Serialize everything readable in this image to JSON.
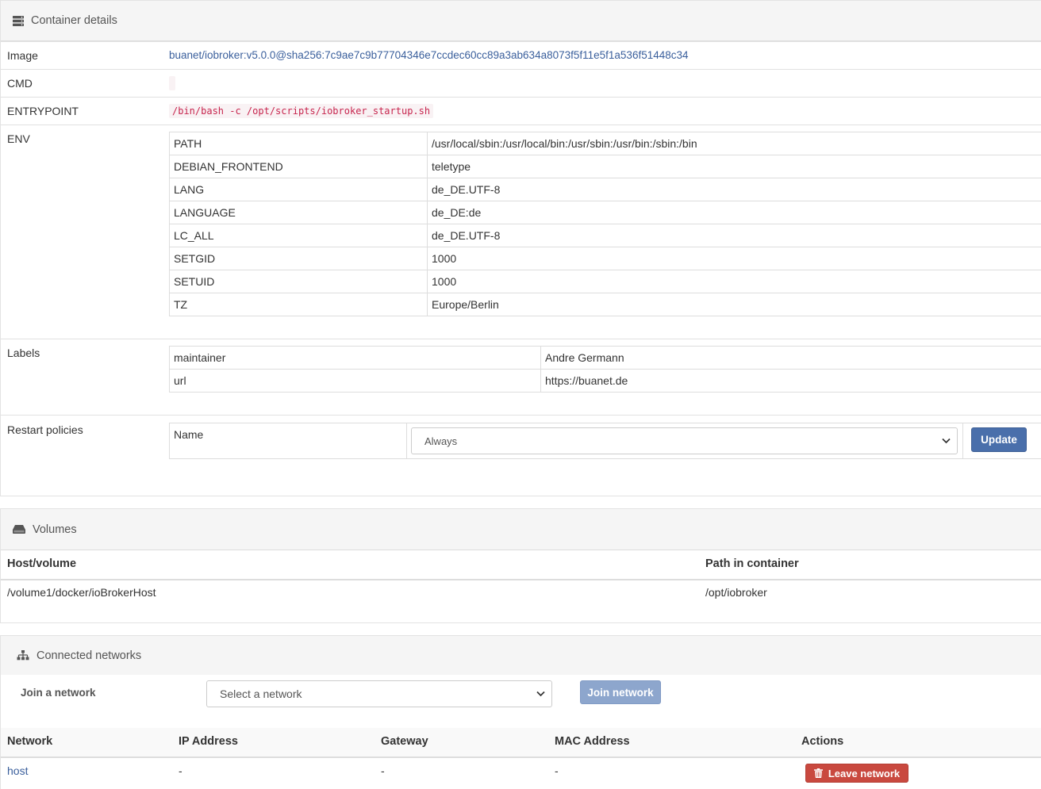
{
  "details": {
    "title": "Container details",
    "image": {
      "label": "Image",
      "value": "buanet/iobroker:v5.0.0@sha256:7c9ae7c9b77704346e7ccdec60cc89a3ab634a8073f5f11e5f1a536f51448c34"
    },
    "cmd": {
      "label": "CMD"
    },
    "entrypoint": {
      "label": "ENTRYPOINT",
      "value": "/bin/bash -c /opt/scripts/iobroker_startup.sh"
    },
    "env": {
      "label": "ENV",
      "rows": [
        {
          "key": "PATH",
          "value": "/usr/local/sbin:/usr/local/bin:/usr/sbin:/usr/bin:/sbin:/bin"
        },
        {
          "key": "DEBIAN_FRONTEND",
          "value": "teletype"
        },
        {
          "key": "LANG",
          "value": "de_DE.UTF-8"
        },
        {
          "key": "LANGUAGE",
          "value": "de_DE:de"
        },
        {
          "key": "LC_ALL",
          "value": "de_DE.UTF-8"
        },
        {
          "key": "SETGID",
          "value": "1000"
        },
        {
          "key": "SETUID",
          "value": "1000"
        },
        {
          "key": "TZ",
          "value": "Europe/Berlin"
        }
      ]
    },
    "labels": {
      "label": "Labels",
      "rows": [
        {
          "key": "maintainer",
          "value": "Andre Germann"
        },
        {
          "key": "url",
          "value": "https://buanet.de"
        }
      ]
    },
    "restart": {
      "label": "Restart policies",
      "name_label": "Name",
      "selected": "Always",
      "update_label": "Update"
    }
  },
  "volumes": {
    "title": "Volumes",
    "headers": {
      "host": "Host/volume",
      "path": "Path in container"
    },
    "rows": [
      {
        "host": "/volume1/docker/ioBrokerHost",
        "path": "/opt/iobroker"
      }
    ]
  },
  "networks": {
    "title": "Connected networks",
    "join_label": "Join a network",
    "select_placeholder": "Select a network",
    "join_button": "Join network",
    "headers": {
      "network": "Network",
      "ip": "IP Address",
      "gateway": "Gateway",
      "mac": "MAC Address",
      "actions": "Actions"
    },
    "rows": [
      {
        "network": "host",
        "ip": "-",
        "gateway": "-",
        "mac": "-",
        "action": "Leave network"
      }
    ]
  },
  "colors": {
    "link": "#3a5f9c",
    "primary": "#4a6fab",
    "danger": "#c9493f",
    "code": "#c7254e"
  }
}
